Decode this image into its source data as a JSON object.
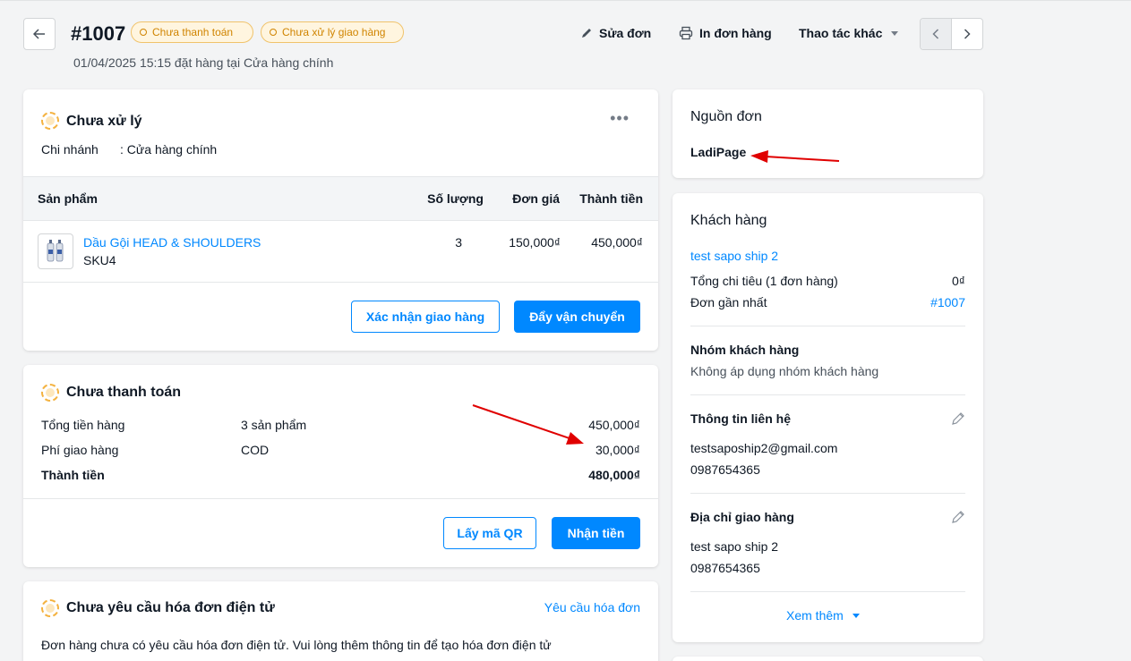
{
  "header": {
    "order_no": "#1007",
    "badge_payment": "Chưa thanh toán",
    "badge_fulfill": "Chưa xử lý giao hàng",
    "subtitle": "01/04/2025 15:15 đặt hàng tại Cửa hàng chính",
    "edit_label": "Sửa đơn",
    "print_label": "In đơn hàng",
    "more_label": "Thao tác khác"
  },
  "fulfillment": {
    "title": "Chưa xử lý",
    "branch_label": "Chi nhánh",
    "branch_value": ": Cửa hàng chính",
    "columns": [
      "Sản phẩm",
      "Số lượng",
      "Đơn giá",
      "Thành tiền"
    ],
    "item": {
      "name": "Dầu Gội HEAD & SHOULDERS",
      "sku": "SKU4",
      "qty": "3",
      "price": "150,000₫",
      "total": "450,000₫"
    },
    "confirm_btn": "Xác nhận giao hàng",
    "push_btn": "Đẩy vận chuyển"
  },
  "payment": {
    "title": "Chưa thanh toán",
    "rows": [
      {
        "label": "Tổng tiền hàng",
        "mid": "3 sản phẩm",
        "value": "450,000₫"
      },
      {
        "label": "Phí giao hàng",
        "mid": "COD",
        "value": "30,000₫"
      },
      {
        "label": "Thành tiền",
        "mid": "",
        "value": "480,000₫"
      }
    ],
    "qr_btn": "Lấy mã QR",
    "receive_btn": "Nhận tiền"
  },
  "invoice": {
    "title": "Chưa yêu cầu hóa đơn điện tử",
    "request_link": "Yêu cầu hóa đơn",
    "note": "Đơn hàng chưa có yêu cầu hóa đơn điện tử. Vui lòng thêm thông tin để tạo hóa đơn điện tử"
  },
  "source": {
    "title": "Nguồn đơn",
    "value": "LadiPage"
  },
  "customer": {
    "title": "Khách hàng",
    "name": "test sapo ship 2",
    "spend_label": "Tổng chi tiêu (1 đơn hàng)",
    "spend_value": "0₫",
    "recent_label": "Đơn gần nhất",
    "recent_value": "#1007",
    "group_title": "Nhóm khách hàng",
    "group_value": "Không áp dụng nhóm khách hàng",
    "contact_title": "Thông tin liên hệ",
    "email": "testsapoship2@gmail.com",
    "phone": "0987654365",
    "address_title": "Địa chỉ giao hàng",
    "address_name": "test sapo ship 2",
    "address_phone": "0987654365",
    "see_more": "Xem thêm"
  },
  "colors": {
    "accent": "#0088ff",
    "warning": "#d08400",
    "annotation": "#e00000"
  }
}
